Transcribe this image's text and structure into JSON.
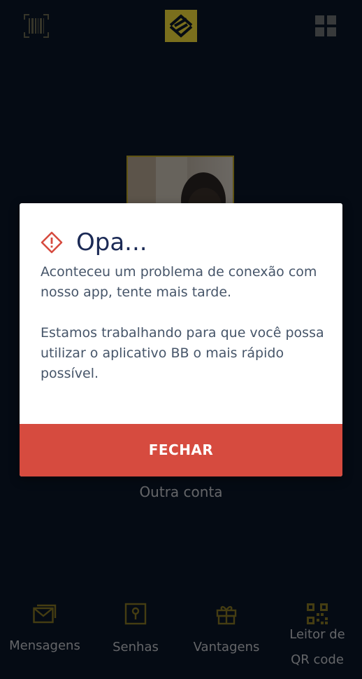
{
  "background": {
    "other_account": "Outra conta",
    "nav": [
      {
        "label": "Mensagens",
        "icon": "messages-icon"
      },
      {
        "label": "Senhas",
        "icon": "passwords-icon"
      },
      {
        "label": "Vantagens",
        "icon": "gift-icon"
      },
      {
        "label_line1": "Leitor de",
        "label_line2": "QR code",
        "icon": "qr-code-icon"
      }
    ]
  },
  "dialog": {
    "title": "Opa...",
    "message1": "Aconteceu um problema de conexão com nosso app, tente mais tarde.",
    "message2": "Estamos trabalhando para que você possa utilizar o aplicativo BB o mais rápido possível.",
    "close_label": "FECHAR"
  },
  "colors": {
    "background": "#0a1729",
    "accent_yellow": "#f4df3a",
    "button_red": "#d64b3f",
    "title_navy": "#1b2a55"
  }
}
